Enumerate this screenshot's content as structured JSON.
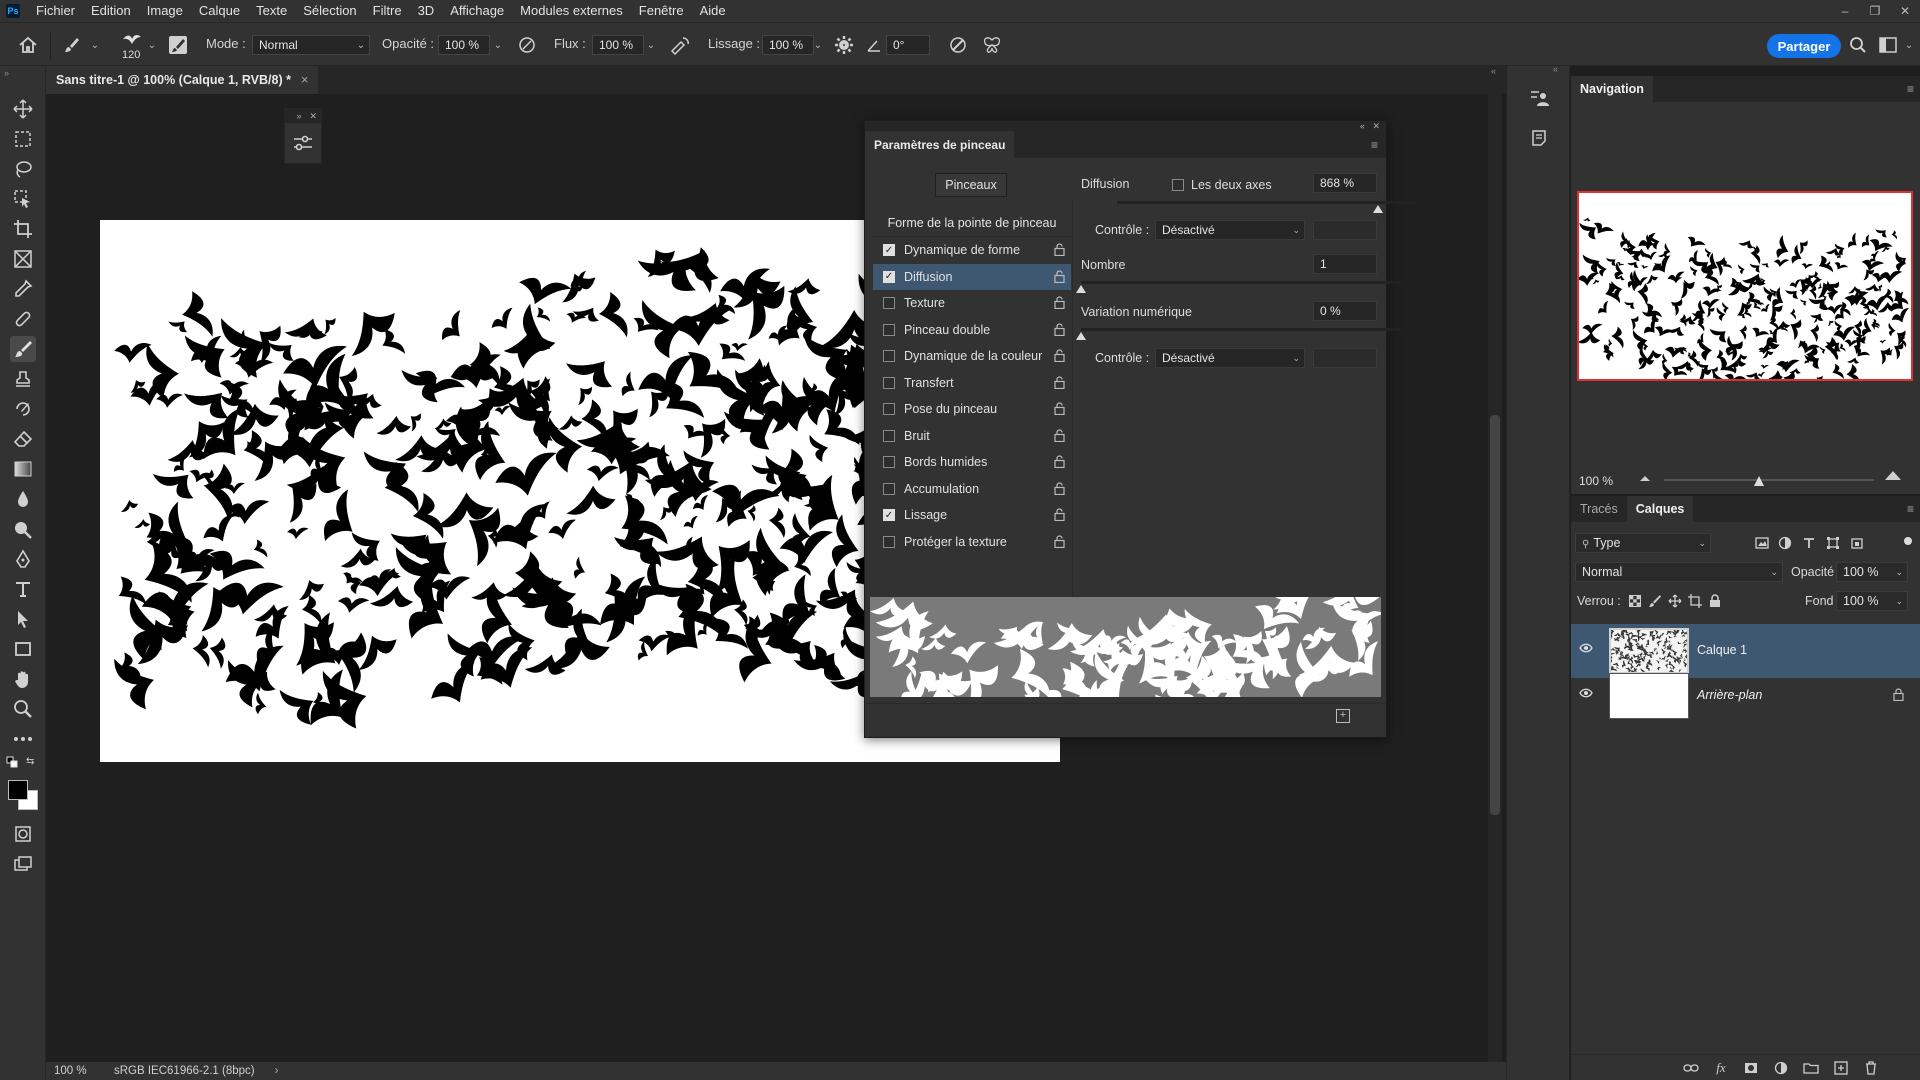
{
  "app": {
    "logo": "Ps",
    "menu": [
      "Fichier",
      "Edition",
      "Image",
      "Calque",
      "Texte",
      "Sélection",
      "Filtre",
      "3D",
      "Affichage",
      "Modules externes",
      "Fenêtre",
      "Aide"
    ],
    "window_controls": [
      "–",
      "❐",
      "✕"
    ]
  },
  "options": {
    "brush_size": "120",
    "mode_label": "Mode :",
    "mode_value": "Normal",
    "opacity_label": "Opacité :",
    "opacity_value": "100 %",
    "flow_label": "Flux :",
    "flow_value": "100 %",
    "smoothing_label": "Lissage :",
    "smoothing_value": "100 %",
    "angle_value": "0°",
    "share_label": "Partager"
  },
  "document": {
    "tab_title": "Sans titre-1 @ 100% (Calque 1, RVB/8) *",
    "tab_close": "×"
  },
  "status": {
    "zoom": "100 %",
    "profile": "sRGB IEC61966-2.1 (8bpc)",
    "arrow": "›"
  },
  "brush_panel": {
    "title": "Paramètres de pinceau",
    "brushes_button": "Pinceaux",
    "list_header": "Forme de la pointe de pinceau",
    "items": [
      {
        "label": "Dynamique de forme",
        "checked": true,
        "selected": false
      },
      {
        "label": "Diffusion",
        "checked": true,
        "selected": true
      },
      {
        "label": "Texture",
        "checked": false,
        "selected": false
      },
      {
        "label": "Pinceau double",
        "checked": false,
        "selected": false
      },
      {
        "label": "Dynamique de la couleur",
        "checked": false,
        "selected": false
      },
      {
        "label": "Transfert",
        "checked": false,
        "selected": false
      },
      {
        "label": "Pose du pinceau",
        "checked": false,
        "selected": false
      },
      {
        "label": "Bruit",
        "checked": false,
        "selected": false
      },
      {
        "label": "Bords humides",
        "checked": false,
        "selected": false
      },
      {
        "label": "Accumulation",
        "checked": false,
        "selected": false
      },
      {
        "label": "Lissage",
        "checked": true,
        "selected": false
      },
      {
        "label": "Protéger la texture",
        "checked": false,
        "selected": false
      }
    ],
    "scatter_label": "Diffusion",
    "both_axes_label": "Les deux axes",
    "scatter_value": "868 %",
    "control_label": "Contrôle :",
    "control_value": "Désactivé",
    "count_label": "Nombre",
    "count_value": "1",
    "count_jitter_label": "Variation numérique",
    "count_jitter_value": "0 %",
    "control2_label": "Contrôle :",
    "control2_value": "Désactivé",
    "scatter_fraction": 0.87,
    "count_fraction": 0.0,
    "jitter_fraction": 0.0
  },
  "navigator": {
    "tab": "Navigation",
    "zoom": "100 %"
  },
  "layers": {
    "tabs": [
      "Tracés",
      "Calques"
    ],
    "filter_value": "Type",
    "blend_value": "Normal",
    "opacity_label": "Opacité :",
    "opacity_value": "100 %",
    "lock_label": "Verrou :",
    "fill_label": "Fond :",
    "fill_value": "100 %",
    "list": [
      {
        "name": "Calque 1",
        "selected": true,
        "italic": false,
        "locked": false
      },
      {
        "name": "Arrière-plan",
        "selected": false,
        "italic": true,
        "locked": true
      }
    ],
    "bottom_fx": "fx"
  },
  "colors": {
    "accent": "#1473e6",
    "selection": "#3f5872",
    "nav_frame": "#dd3333"
  }
}
